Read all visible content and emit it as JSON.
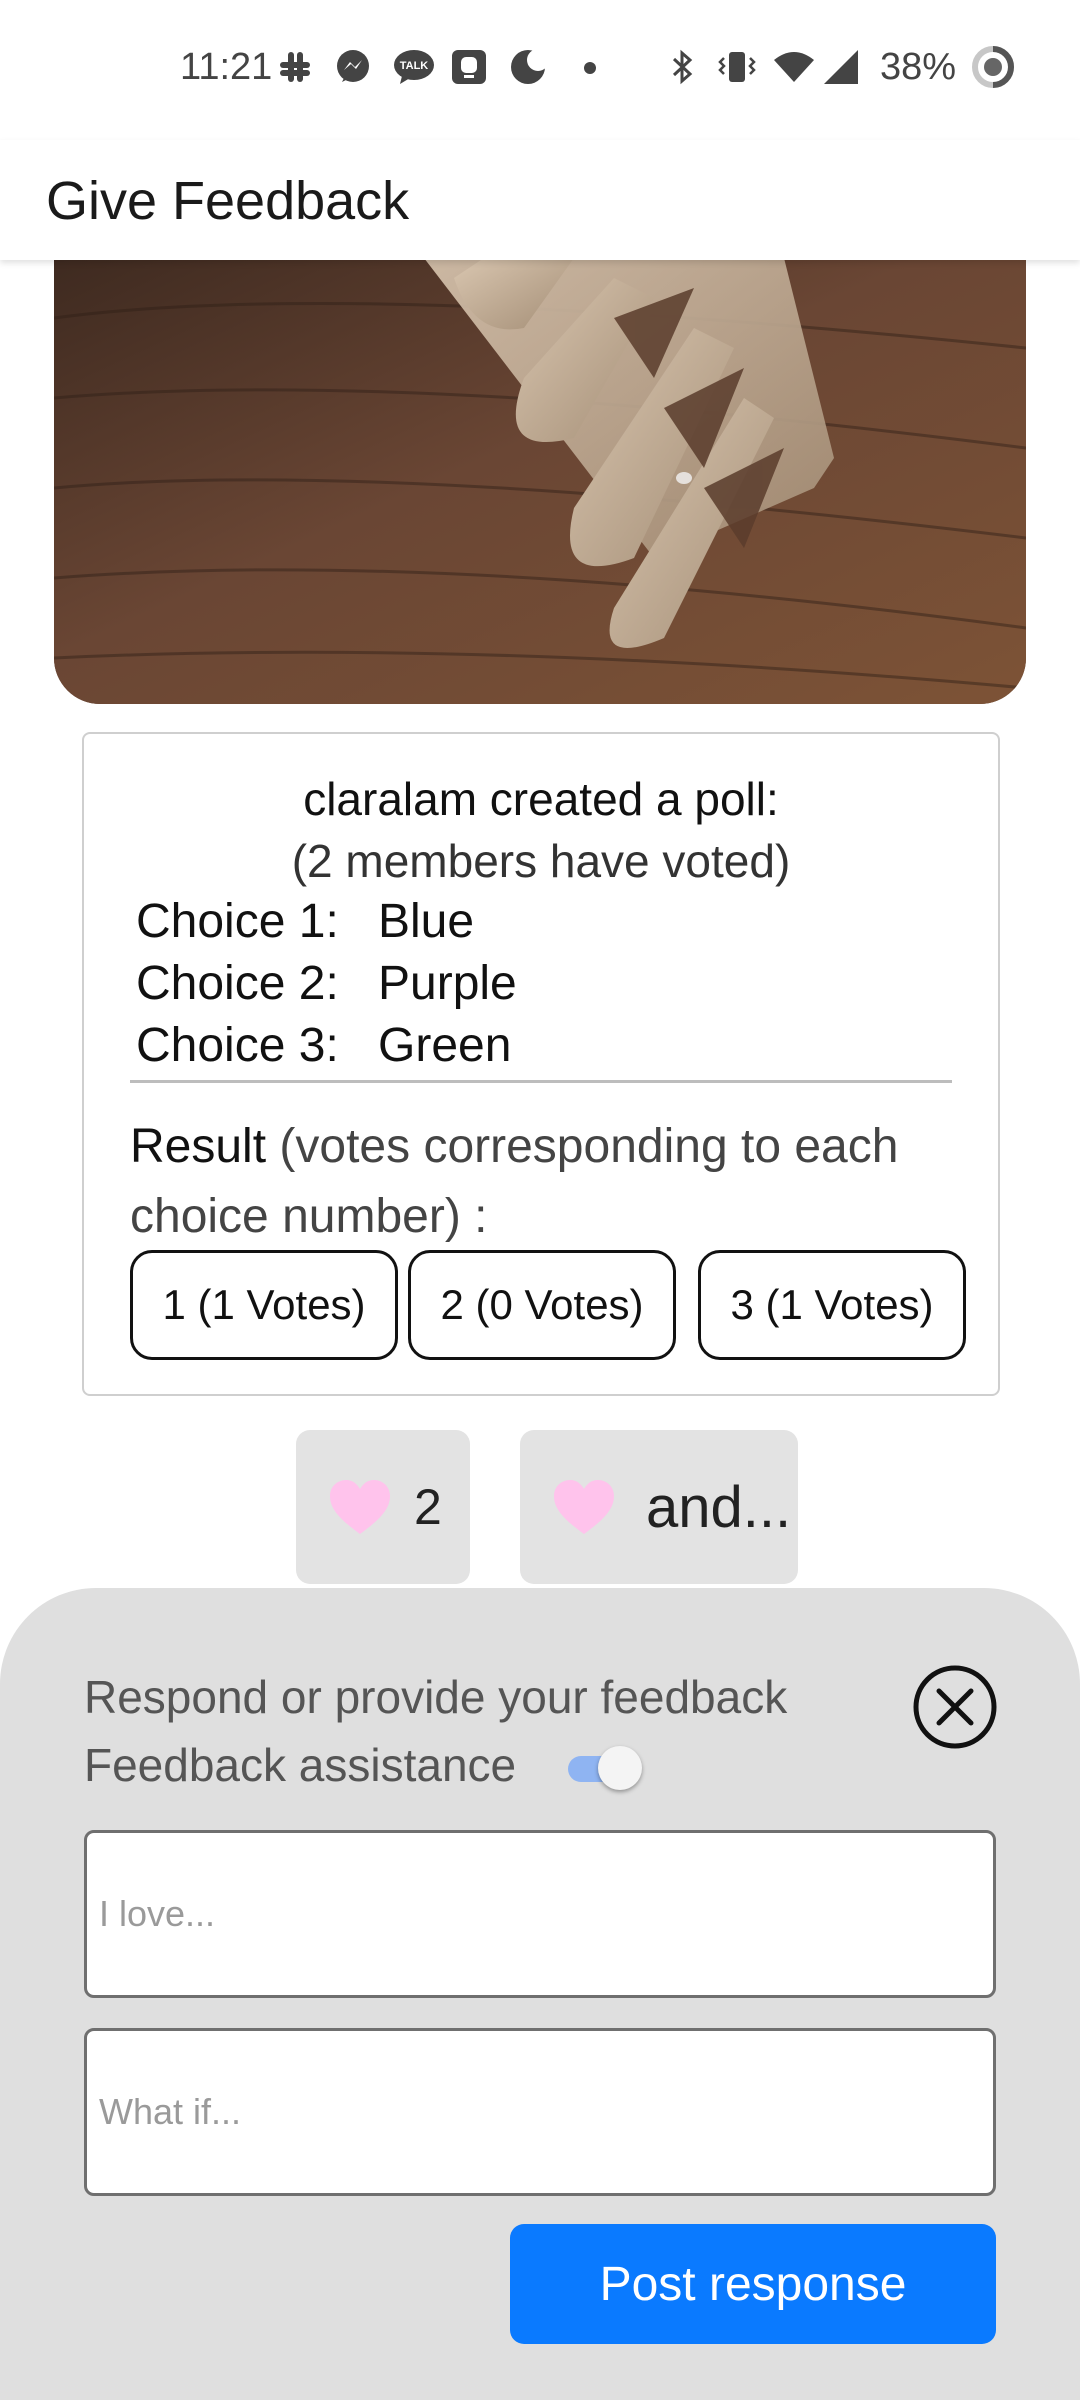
{
  "status_bar": {
    "time": "11:21",
    "battery_text": "38%",
    "icons": [
      "slack-icon",
      "messenger-icon",
      "kakaotalk-icon",
      "notification-app-icon",
      "do-not-disturb-icon",
      "more-notifications-dot",
      "bluetooth-icon",
      "vibrate-icon",
      "wifi-icon",
      "cell-signal-icon",
      "battery-icon"
    ]
  },
  "app_bar": {
    "title": "Give Feedback"
  },
  "post": {
    "image": "hair-claw-clip-photo",
    "poll": {
      "title": "claralam created a poll:",
      "subtitle": "(2 members have voted)",
      "choices": [
        {
          "label": "Choice 1:",
          "value": "Blue"
        },
        {
          "label": "Choice 2:",
          "value": "Purple"
        },
        {
          "label": "Choice 3:",
          "value": "Green"
        }
      ],
      "result_label": "Result",
      "result_note": " (votes corresponding to each choice number) :",
      "vote_buttons": [
        {
          "label": "1 (1 Votes)"
        },
        {
          "label": "2 (0 Votes)"
        },
        {
          "label": "3 (1 Votes)"
        }
      ]
    },
    "reactions": [
      {
        "icon": "heart-icon",
        "count": "2"
      },
      {
        "icon": "heart-icon",
        "text": "and..."
      }
    ]
  },
  "feedback_sheet": {
    "prompt": "Respond or provide your feedback",
    "assistance_label": "Feedback assistance",
    "assistance_enabled": true,
    "love_placeholder": "I love...",
    "whatif_placeholder": "What if...",
    "post_button": "Post response"
  },
  "colors": {
    "accent": "#0a7aff",
    "toggle_track": "#8fb4f2",
    "heart": "#ffc3ec",
    "sheet_background": "#dfdfdf",
    "reaction_background": "#e3e3e3"
  }
}
